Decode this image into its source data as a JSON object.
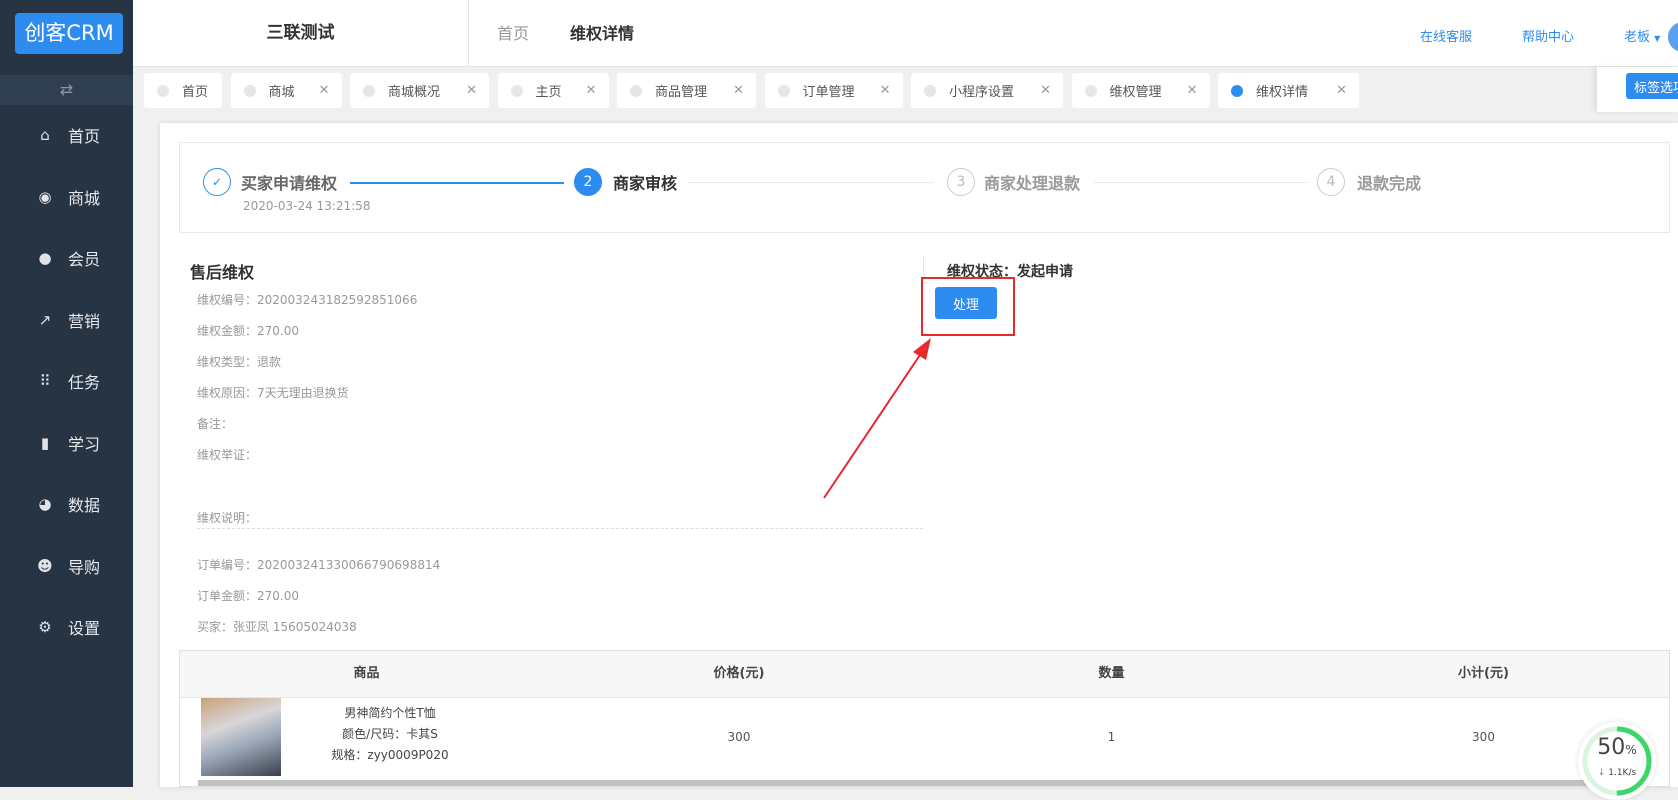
{
  "logo": "创客CRM",
  "sidebar": {
    "toggle_icon": "⇄",
    "items": [
      {
        "label": "首页",
        "icon": "⌂",
        "name": "home"
      },
      {
        "label": "商城",
        "icon": "◉",
        "name": "mall"
      },
      {
        "label": "会员",
        "icon": "●",
        "name": "member"
      },
      {
        "label": "营销",
        "icon": "↗",
        "name": "marketing"
      },
      {
        "label": "任务",
        "icon": "⠿",
        "name": "task"
      },
      {
        "label": "学习",
        "icon": "▮",
        "name": "study"
      },
      {
        "label": "数据",
        "icon": "◕",
        "name": "data"
      },
      {
        "label": "导购",
        "icon": "☻",
        "name": "guide"
      },
      {
        "label": "设置",
        "icon": "⚙",
        "name": "settings"
      }
    ]
  },
  "header": {
    "shop": "三联测试",
    "breadcrumb": [
      "首页",
      "维权详情"
    ],
    "links": [
      "在线客服",
      "帮助中心"
    ],
    "user": "老板"
  },
  "tabs": [
    {
      "label": "首页",
      "closable": false
    },
    {
      "label": "商城",
      "closable": true
    },
    {
      "label": "商城概况",
      "closable": true
    },
    {
      "label": "主页",
      "closable": true
    },
    {
      "label": "商品管理",
      "closable": true
    },
    {
      "label": "订单管理",
      "closable": true
    },
    {
      "label": "小程序设置",
      "closable": true
    },
    {
      "label": "维权管理",
      "closable": true
    },
    {
      "label": "维权详情",
      "closable": true,
      "active": true
    }
  ],
  "tab_options": "标签选项",
  "steps": [
    {
      "num": "✓",
      "label": "买家申请维权",
      "date": "2020-03-24 13:21:58"
    },
    {
      "num": "2",
      "label": "商家审核"
    },
    {
      "num": "3",
      "label": "商家处理退款"
    },
    {
      "num": "4",
      "label": "退款完成"
    }
  ],
  "aftersale": {
    "title": "售后维权",
    "fields": [
      "维权编号：20200324318259285106​6",
      "维权金额：270.00",
      "维权类型：退款",
      "维权原因：7天无理由退换货",
      "备注：",
      "维权举证：",
      "维权说明："
    ],
    "order": [
      "订单编号：20200324133006679069881​4",
      "订单金额：270.00",
      "买家：张亚凤  15605024038"
    ]
  },
  "status": {
    "label": "维权状态：发起申请",
    "button": "处理"
  },
  "table": {
    "headers": [
      "商品",
      "价格(元)",
      "数量",
      "小计(元)"
    ],
    "rows": [
      {
        "name": "男神简约个性T恤",
        "color": "颜色/尺码：卡其S",
        "spec": "规格：zyy0009P020",
        "price": "300",
        "qty": "1",
        "subtotal": "300"
      }
    ]
  },
  "speed": {
    "percent": "50",
    "unit": "%",
    "rate": "1.1K/s",
    "progress": 0.5
  },
  "colors": {
    "primary": "#2d8cf0",
    "sidebar": "#273444",
    "highlight": "#e8282b"
  }
}
